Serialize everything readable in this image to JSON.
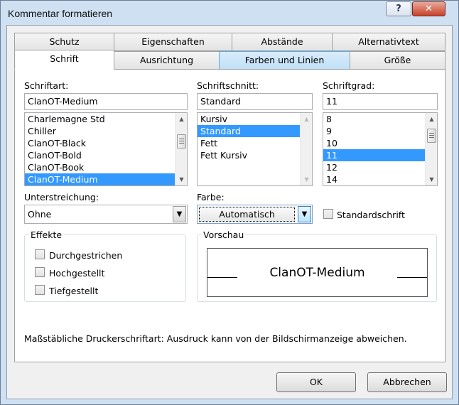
{
  "window": {
    "title": "Kommentar formatieren"
  },
  "titlebar": {
    "help_label": "?",
    "close_label": "✕"
  },
  "tabs": {
    "schutz": "Schutz",
    "eigenschaften": "Eigenschaften",
    "abstaende": "Abstände",
    "alternativtext": "Alternativtext",
    "schrift": "Schrift",
    "ausrichtung": "Ausrichtung",
    "farben_linien": "Farben und Linien",
    "groesse": "Größe"
  },
  "font": {
    "label": "Schriftart:",
    "value": "ClanOT-Medium",
    "items": [
      "Charlemagne Std",
      "Chiller",
      "ClanOT-Black",
      "ClanOT-Bold",
      "ClanOT-Book",
      "ClanOT-Medium"
    ]
  },
  "style": {
    "label": "Schriftschnitt:",
    "value": "Standard",
    "items": [
      "Kursiv",
      "Standard",
      "Fett",
      "Fett Kursiv"
    ]
  },
  "size": {
    "label": "Schriftgrad:",
    "value": "11",
    "items": [
      "8",
      "9",
      "10",
      "11",
      "12",
      "14"
    ]
  },
  "underline": {
    "label": "Unterstreichung:",
    "value": "Ohne"
  },
  "color": {
    "label": "Farbe:",
    "value": "Automatisch"
  },
  "normal_font": {
    "label": "Standardschrift",
    "checked": false
  },
  "effects": {
    "title": "Effekte",
    "strike": "Durchgestrichen",
    "superscript": "Hochgestellt",
    "subscript": "Tiefgestellt"
  },
  "preview": {
    "title": "Vorschau",
    "text": "ClanOT-Medium"
  },
  "info": {
    "text": "Maßstäbliche Druckerschriftart: Ausdruck kann von der Bildschirmanzeige abweichen."
  },
  "buttons": {
    "ok": "OK",
    "cancel": "Abbrechen"
  },
  "colors": {
    "selection": "#3399ff",
    "titlebar_bg": "#cfe0f3",
    "tab_highlight": "#bfe0f7"
  }
}
